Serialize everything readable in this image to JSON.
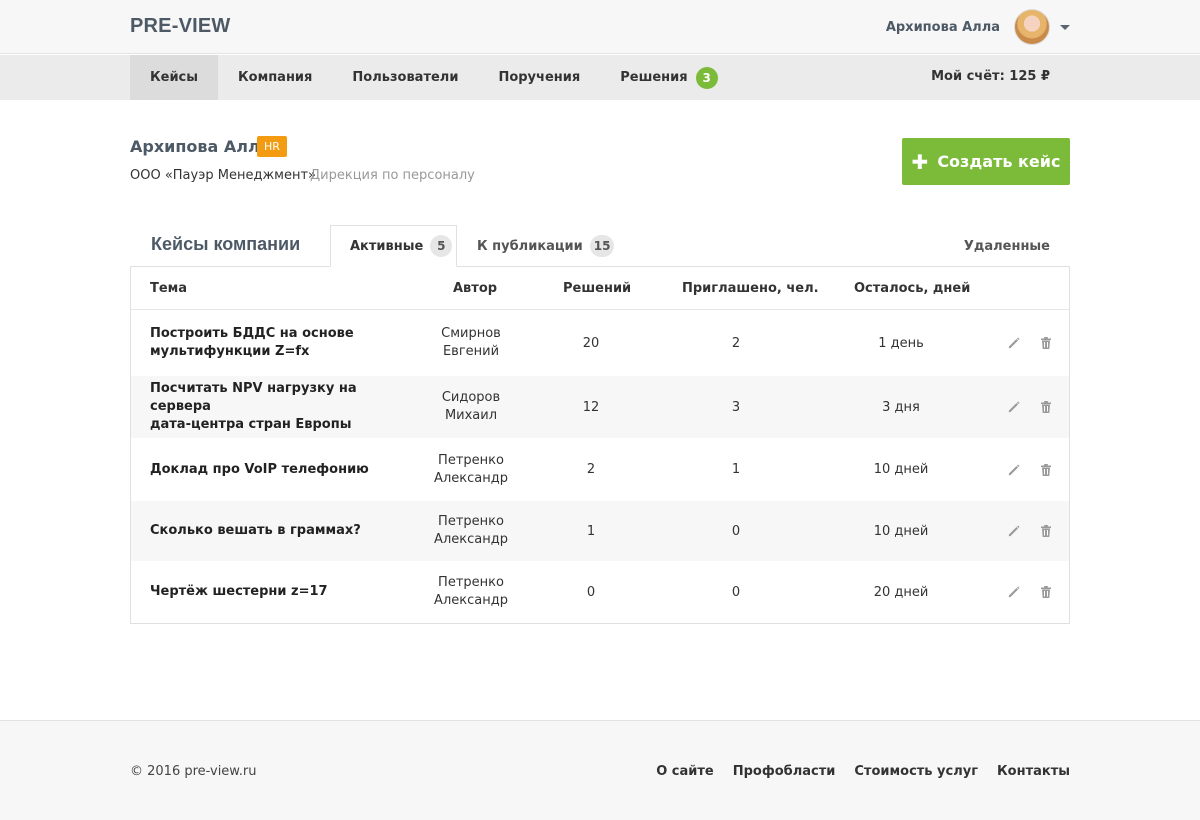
{
  "header": {
    "logo": "PRE-VIEW",
    "user_name": "Архипова Алла"
  },
  "nav": {
    "items": [
      {
        "label": "Кейсы"
      },
      {
        "label": "Компания"
      },
      {
        "label": "Пользователи"
      },
      {
        "label": "Поручения"
      },
      {
        "label": "Решения",
        "badge": "3"
      }
    ],
    "account": "Мой счёт: 125 ₽"
  },
  "profile": {
    "name": "Архипова Алла",
    "role_badge": "HR",
    "company": "ООО «Пауэр Менеджмент»",
    "department": "Дирекция по персоналу",
    "create_button": "Создать кейс"
  },
  "cases": {
    "title": "Кейсы компании",
    "tabs": [
      {
        "label": "Активные",
        "count": "5"
      },
      {
        "label": "К публикации",
        "count": "15"
      }
    ],
    "deleted_tab": "Удаленные",
    "columns": [
      "Тема",
      "Автор",
      "Решений",
      "Приглашено, чел.",
      "Осталось, дней"
    ],
    "rows": [
      {
        "topic_1": "Построить БДДС на основе",
        "topic_2": "мультифункции Z=fx",
        "author_1": "Смирнов",
        "author_2": "Евгений",
        "solutions": "20",
        "invited": "2",
        "left": "1 день"
      },
      {
        "topic_1": "Посчитать NPV нагрузку на сервера",
        "topic_2": "дата-центра стран Европы",
        "author_1": "Сидоров",
        "author_2": "Михаил",
        "solutions": "12",
        "invited": "3",
        "left": "3 дня"
      },
      {
        "topic_1": "Доклад про VoIP телефонию",
        "topic_2": "",
        "author_1": "Петренко",
        "author_2": "Александр",
        "solutions": "2",
        "invited": "1",
        "left": "10 дней"
      },
      {
        "topic_1": "Сколько вешать в граммах?",
        "topic_2": "",
        "author_1": "Петренко",
        "author_2": "Александр",
        "solutions": "1",
        "invited": "0",
        "left": "10 дней"
      },
      {
        "topic_1": "Чертёж шестерни z=17",
        "topic_2": "",
        "author_1": "Петренко",
        "author_2": "Александр",
        "solutions": "0",
        "invited": "0",
        "left": "20 дней"
      }
    ]
  },
  "footer": {
    "copyright": "© 2016 pre-view.ru",
    "links": [
      "О сайте",
      "Профобласти",
      "Стоимость услуг",
      "Контакты"
    ]
  },
  "colors": {
    "accent_green": "#7cbb3a",
    "hr_orange": "#f39c12",
    "title_slate": "#4d5a66"
  }
}
